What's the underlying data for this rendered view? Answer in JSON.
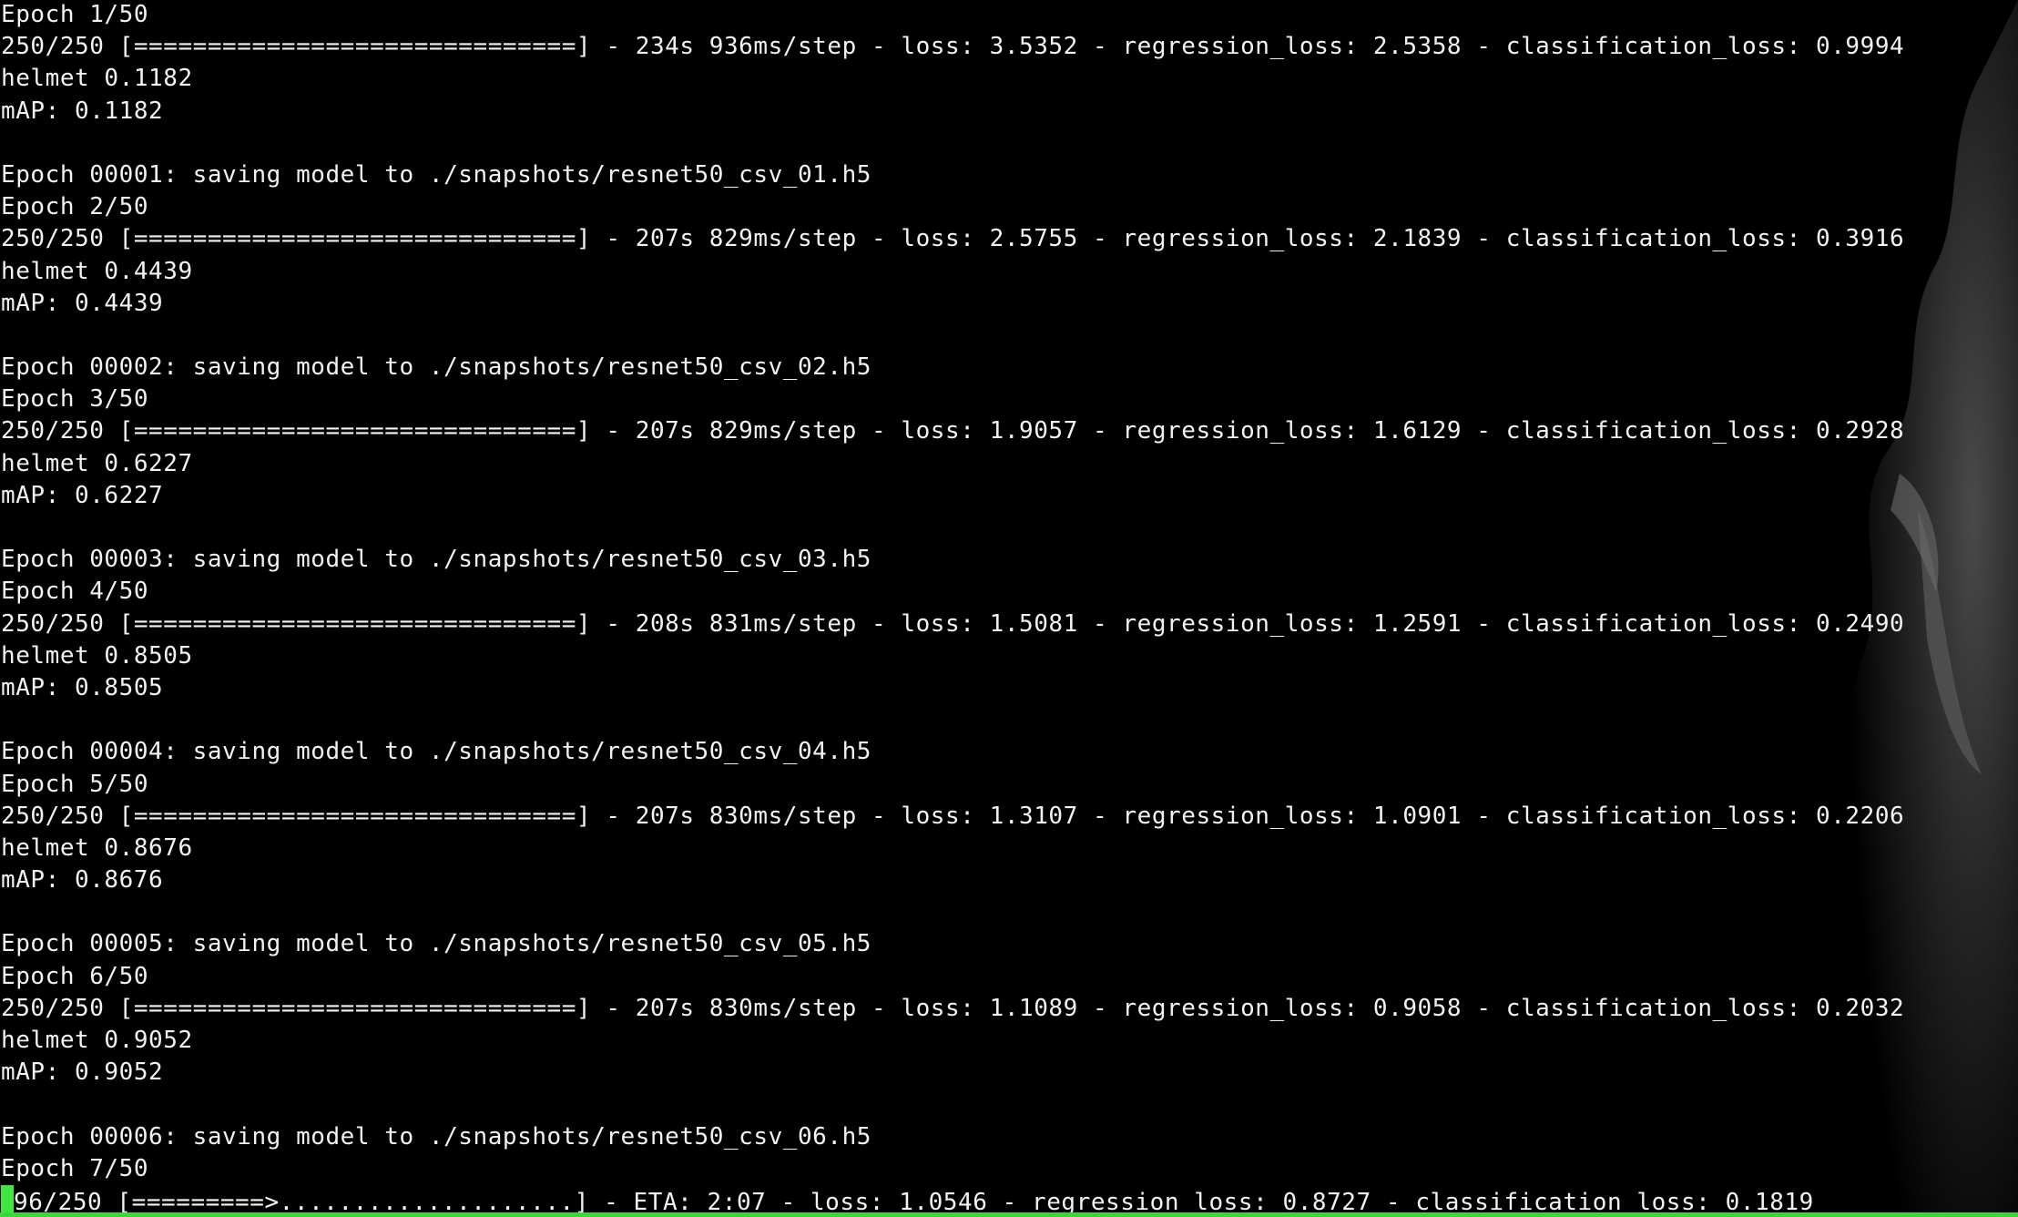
{
  "terminal": {
    "colors": {
      "background": "#000000",
      "text": "#f2f2f2",
      "cursor": "#3fe83f",
      "status_bar": "#39d83a"
    },
    "wallpaper_icon": "eagle-silhouette-icon",
    "lines": [
      "Epoch 1/50",
      "250/250 [==============================] - 234s 936ms/step - loss: 3.5352 - regression_loss: 2.5358 - classification_loss: 0.9994",
      "helmet 0.1182",
      "mAP: 0.1182",
      "",
      "Epoch 00001: saving model to ./snapshots/resnet50_csv_01.h5",
      "Epoch 2/50",
      "250/250 [==============================] - 207s 829ms/step - loss: 2.5755 - regression_loss: 2.1839 - classification_loss: 0.3916",
      "helmet 0.4439",
      "mAP: 0.4439",
      "",
      "Epoch 00002: saving model to ./snapshots/resnet50_csv_02.h5",
      "Epoch 3/50",
      "250/250 [==============================] - 207s 829ms/step - loss: 1.9057 - regression_loss: 1.6129 - classification_loss: 0.2928",
      "helmet 0.6227",
      "mAP: 0.6227",
      "",
      "Epoch 00003: saving model to ./snapshots/resnet50_csv_03.h5",
      "Epoch 4/50",
      "250/250 [==============================] - 208s 831ms/step - loss: 1.5081 - regression_loss: 1.2591 - classification_loss: 0.2490",
      "helmet 0.8505",
      "mAP: 0.8505",
      "",
      "Epoch 00004: saving model to ./snapshots/resnet50_csv_04.h5",
      "Epoch 5/50",
      "250/250 [==============================] - 207s 830ms/step - loss: 1.3107 - regression_loss: 1.0901 - classification_loss: 0.2206",
      "helmet 0.8676",
      "mAP: 0.8676",
      "",
      "Epoch 00005: saving model to ./snapshots/resnet50_csv_05.h5",
      "Epoch 6/50",
      "250/250 [==============================] - 207s 830ms/step - loss: 1.1089 - regression_loss: 0.9058 - classification_loss: 0.2032",
      "helmet 0.9052",
      "mAP: 0.9052",
      "",
      "Epoch 00006: saving model to ./snapshots/resnet50_csv_06.h5",
      "Epoch 7/50"
    ],
    "progress_line": {
      "cursor_char": "",
      "text": "96/250 [=========>....................] - ETA: 2:07 - loss: 1.0546 - regression_loss: 0.8727 - classification_loss: 0.1819"
    }
  }
}
